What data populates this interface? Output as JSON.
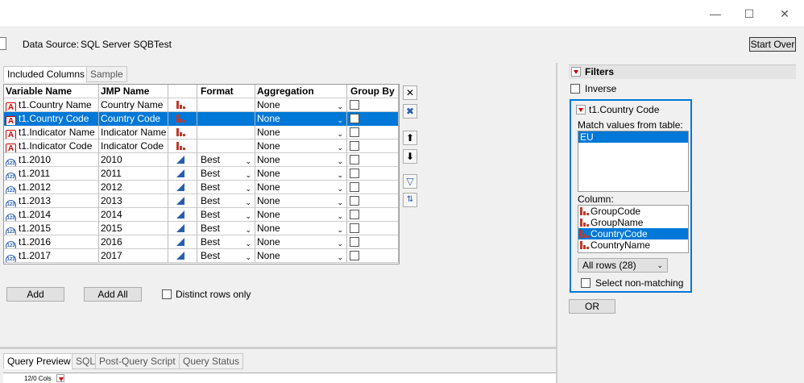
{
  "window": {
    "minimize": "—",
    "maximize": "☐",
    "close": "✕"
  },
  "header": {
    "data_source_label": "Data Source:",
    "data_source_value": "SQL Server SQBTest",
    "start_over": "Start Over"
  },
  "tabs": [
    "Included Columns",
    "Sample"
  ],
  "grid": {
    "headers": [
      "Variable Name",
      "JMP Name",
      "",
      "Format",
      "Aggregation",
      "Group By"
    ],
    "rows": [
      {
        "type": "char",
        "var": "t1.Country Name",
        "jmp": "Country Name",
        "format": "",
        "agg": "None",
        "selected": false
      },
      {
        "type": "char",
        "var": "t1.Country Code",
        "jmp": "Country Code",
        "format": "",
        "agg": "None",
        "selected": true
      },
      {
        "type": "char",
        "var": "t1.Indicator Name",
        "jmp": "Indicator Name",
        "format": "",
        "agg": "None",
        "selected": false
      },
      {
        "type": "char",
        "var": "t1.Indicator Code",
        "jmp": "Indicator Code",
        "format": "",
        "agg": "None",
        "selected": false
      },
      {
        "type": "num",
        "var": "t1.2010",
        "jmp": "2010",
        "format": "Best",
        "agg": "None",
        "selected": false
      },
      {
        "type": "num",
        "var": "t1.2011",
        "jmp": "2011",
        "format": "Best",
        "agg": "None",
        "selected": false
      },
      {
        "type": "num",
        "var": "t1.2012",
        "jmp": "2012",
        "format": "Best",
        "agg": "None",
        "selected": false
      },
      {
        "type": "num",
        "var": "t1.2013",
        "jmp": "2013",
        "format": "Best",
        "agg": "None",
        "selected": false
      },
      {
        "type": "num",
        "var": "t1.2014",
        "jmp": "2014",
        "format": "Best",
        "agg": "None",
        "selected": false
      },
      {
        "type": "num",
        "var": "t1.2015",
        "jmp": "2015",
        "format": "Best",
        "agg": "None",
        "selected": false
      },
      {
        "type": "num",
        "var": "t1.2016",
        "jmp": "2016",
        "format": "Best",
        "agg": "None",
        "selected": false
      },
      {
        "type": "num",
        "var": "t1.2017",
        "jmp": "2017",
        "format": "Best",
        "agg": "None",
        "selected": false
      }
    ]
  },
  "actions": {
    "add": "Add",
    "add_all": "Add All",
    "distinct": "Distinct rows only"
  },
  "side_icons": [
    "remove-icon",
    "remove-all-icon",
    "move-up-icon",
    "move-down-icon",
    "filter-icon",
    "sort-icon"
  ],
  "filters": {
    "title": "Filters",
    "inverse": "Inverse",
    "filter_name": "t1.Country Code",
    "match_label": "Match values from table:",
    "match_values": [
      "EU"
    ],
    "column_label": "Column:",
    "columns": [
      "GroupCode",
      "GroupName",
      "CountryCode",
      "CountryName"
    ],
    "selected_column": "CountryCode",
    "rows_select": "All rows (28)",
    "select_nonmatching": "Select non-matching",
    "or_button": "OR"
  },
  "bottom_tabs": [
    "Query Preview",
    "SQL",
    "Post-Query Script",
    "Query Status"
  ],
  "preview_cols": "12/0 Cols",
  "colors": {
    "accent": "#0078d7",
    "char_icon": "#c00000",
    "num_icon": "#2a5db0"
  }
}
